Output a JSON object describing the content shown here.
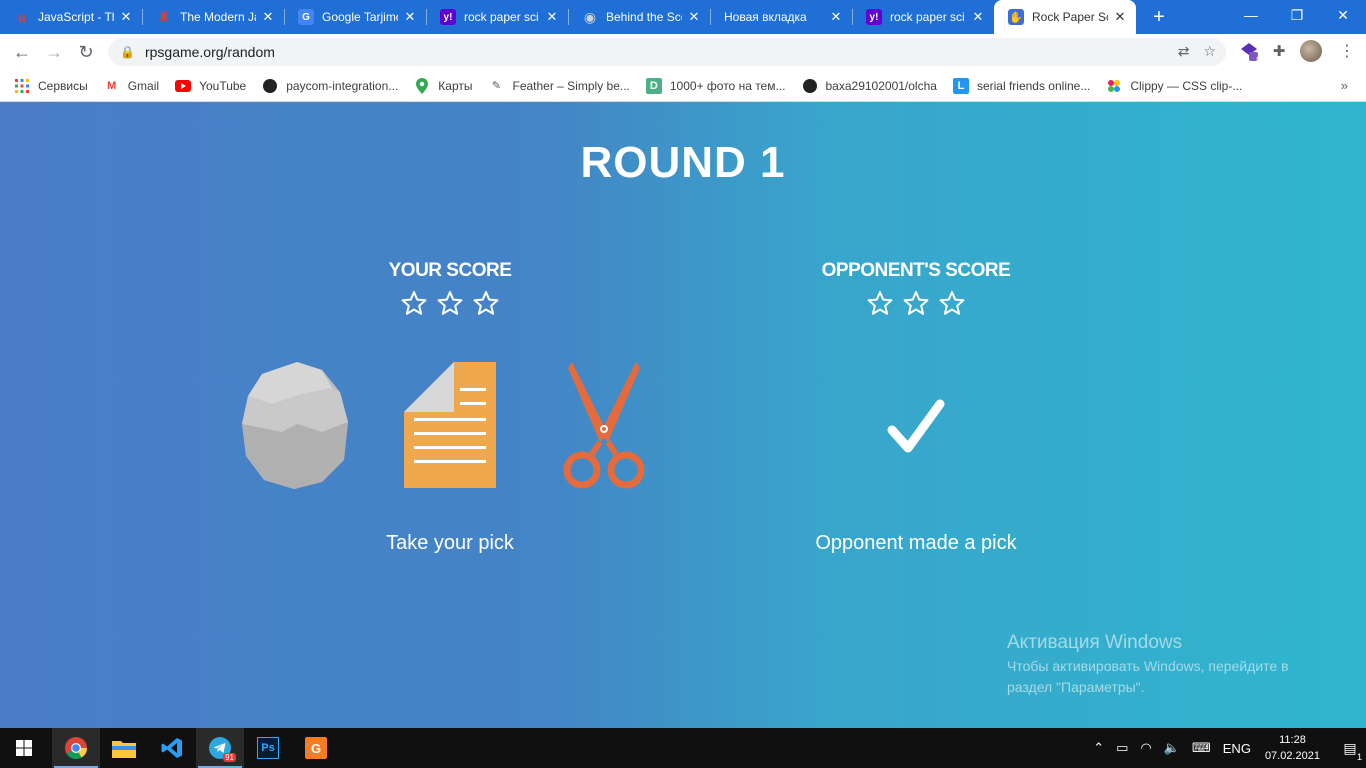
{
  "browser": {
    "tabs": [
      {
        "title": "JavaScript - Th",
        "favicon": "red-u-icon",
        "color": "#e53935"
      },
      {
        "title": "The Modern Ja",
        "favicon": "figure-icon",
        "color": "#e53935"
      },
      {
        "title": "Google Tarjimo",
        "favicon": "google-translate-icon",
        "color": "#4285f4"
      },
      {
        "title": "rock paper sci",
        "favicon": "yahoo-icon",
        "color": "#6001d2"
      },
      {
        "title": "Behind the Sce",
        "favicon": "globe-icon",
        "color": "#888888"
      },
      {
        "title": "Новая вкладка",
        "favicon": "",
        "color": ""
      },
      {
        "title": "rock paper sci",
        "favicon": "yahoo-icon",
        "color": "#6001d2"
      },
      {
        "title": "Rock Paper Sc",
        "favicon": "hand-icon",
        "color": "#3b6fd6"
      }
    ],
    "active_tab": 7,
    "url": "rpsgame.org/random",
    "extension_badge": "8",
    "bookmarks": [
      {
        "label": "Сервисы",
        "icon": "apps-grid-icon"
      },
      {
        "label": "Gmail",
        "icon": "gmail-icon"
      },
      {
        "label": "YouTube",
        "icon": "youtube-icon"
      },
      {
        "label": "paycom-integration...",
        "icon": "github-icon"
      },
      {
        "label": "Карты",
        "icon": "maps-icon"
      },
      {
        "label": "Feather – Simply be...",
        "icon": "feather-icon"
      },
      {
        "label": "1000+ фото на тем...",
        "icon": "d-icon"
      },
      {
        "label": "baxa29102001/olcha",
        "icon": "github-icon"
      },
      {
        "label": "serial friends online...",
        "icon": "l-icon"
      },
      {
        "label": "Clippy — CSS clip-...",
        "icon": "clippy-icon"
      }
    ]
  },
  "game": {
    "round_title": "ROUND 1",
    "your_score_label": "YOUR SCORE",
    "opponent_score_label": "OPPONENT'S SCORE",
    "your_stars": 0,
    "opponent_stars": 0,
    "max_stars": 3,
    "your_prompt": "Take your pick",
    "opponent_status": "Opponent made a pick",
    "choices": [
      "rock",
      "paper",
      "scissors"
    ]
  },
  "watermark": {
    "title": "Активация Windows",
    "subtitle": "Чтобы активировать Windows, перейдите в раздел \"Параметры\"."
  },
  "taskbar": {
    "apps": [
      "chrome-icon",
      "file-explorer-icon",
      "vscode-icon",
      "telegram-icon",
      "photoshop-icon",
      "app-g-icon"
    ],
    "telegram_badge": "91",
    "language": "ENG",
    "time": "11:28",
    "date": "07.02.2021",
    "notification_count": "1"
  },
  "colors": {
    "gradient_left": "#4a7ec7",
    "gradient_right": "#2fb6ce",
    "paper": "#f0a84e",
    "scissors": "#e46b3d",
    "rock": "#bdbdbd"
  }
}
